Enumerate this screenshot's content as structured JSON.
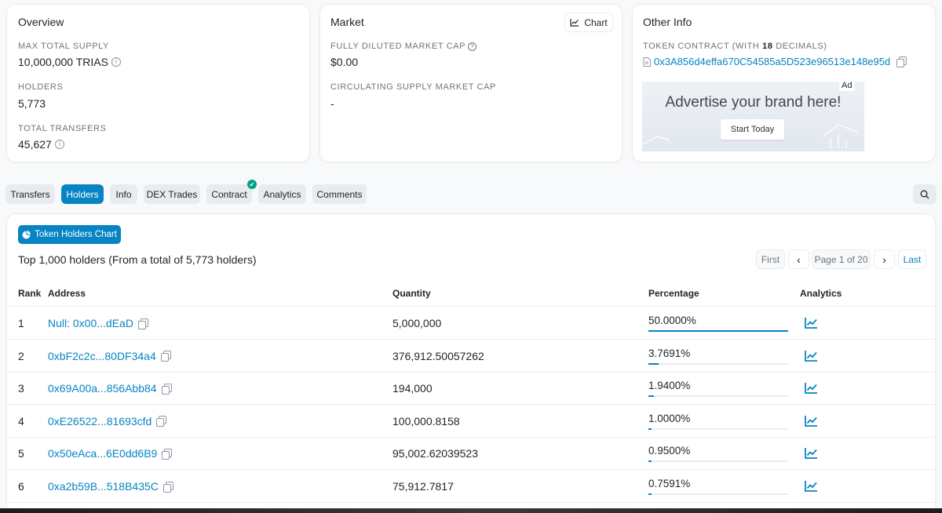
{
  "overview": {
    "title": "Overview",
    "max_supply_label": "MAX TOTAL SUPPLY",
    "max_supply_value": "10,000,000 TRIAS",
    "holders_label": "HOLDERS",
    "holders_value": "5,773",
    "transfers_label": "TOTAL TRANSFERS",
    "transfers_value": "45,627"
  },
  "market": {
    "title": "Market",
    "chart_label": "Chart",
    "fdmc_label": "FULLY DILUTED MARKET CAP",
    "fdmc_value": "$0.00",
    "csmc_label": "CIRCULATING SUPPLY MARKET CAP",
    "csmc_value": "-"
  },
  "other_info": {
    "title": "Other Info",
    "contract_label_pre": "TOKEN CONTRACT (WITH ",
    "contract_decimals": "18",
    "contract_label_post": " DECIMALS)",
    "contract_address": "0x3A856d4effa670C54585a5D523e96513e148e95d",
    "ad_headline": "Advertise your brand here!",
    "ad_cta": "Start Today",
    "ad_badge": "Ad"
  },
  "tabs": [
    {
      "label": "Transfers",
      "active": false
    },
    {
      "label": "Holders",
      "active": true
    },
    {
      "label": "Info",
      "active": false
    },
    {
      "label": "DEX Trades",
      "active": false
    },
    {
      "label": "Contract",
      "active": false,
      "verified": true
    },
    {
      "label": "Analytics",
      "active": false
    },
    {
      "label": "Comments",
      "active": false
    }
  ],
  "holders": {
    "chart_button": "Token Holders Chart",
    "summary": "Top 1,000 holders (From a total of 5,773 holders)",
    "pagination": {
      "first": "First",
      "prev": "‹",
      "page": "Page 1 of 20",
      "next": "›",
      "last": "Last"
    },
    "columns": {
      "rank": "Rank",
      "address": "Address",
      "quantity": "Quantity",
      "percentage": "Percentage",
      "analytics": "Analytics"
    },
    "rows": [
      {
        "rank": "1",
        "address": "Null: 0x00...dEaD",
        "quantity": "5,000,000",
        "percentage": "50.0000%",
        "pct_value": 50.0
      },
      {
        "rank": "2",
        "address": "0xbF2c2c...80DF34a4",
        "quantity": "376,912.50057262",
        "percentage": "3.7691%",
        "pct_value": 3.7691
      },
      {
        "rank": "3",
        "address": "0x69A00a...856Abb84",
        "quantity": "194,000",
        "percentage": "1.9400%",
        "pct_value": 1.94
      },
      {
        "rank": "4",
        "address": "0xE26522...81693cfd",
        "quantity": "100,000.8158",
        "percentage": "1.0000%",
        "pct_value": 1.0
      },
      {
        "rank": "5",
        "address": "0x50eAca...6E0dd6B9",
        "quantity": "95,002.62039523",
        "percentage": "0.9500%",
        "pct_value": 0.95
      },
      {
        "rank": "6",
        "address": "0xa2b59B...518B435C",
        "quantity": "75,912.7817",
        "percentage": "0.7591%",
        "pct_value": 0.7591
      }
    ]
  },
  "colors": {
    "accent": "#0784c3",
    "verified": "#00a186"
  }
}
